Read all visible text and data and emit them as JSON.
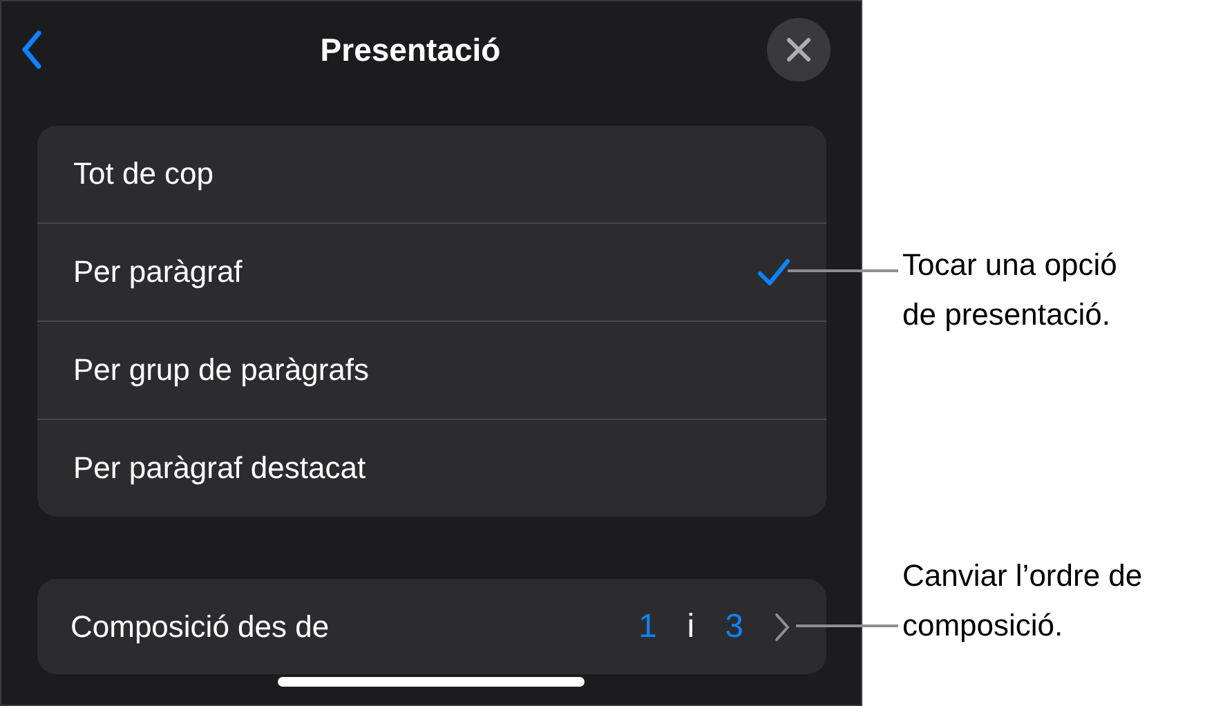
{
  "header": {
    "title": "Presentació"
  },
  "options": [
    {
      "label": "Tot de cop",
      "selected": false
    },
    {
      "label": "Per paràgraf",
      "selected": true
    },
    {
      "label": "Per grup de paràgrafs",
      "selected": false
    },
    {
      "label": "Per paràgraf destacat",
      "selected": false
    }
  ],
  "build_from": {
    "label": "Composició des de",
    "from": "1",
    "separator": "i",
    "to": "3"
  },
  "callouts": [
    {
      "text": "Tocar una opció de presentació."
    },
    {
      "text": "Canviar l’ordre de composició."
    }
  ]
}
